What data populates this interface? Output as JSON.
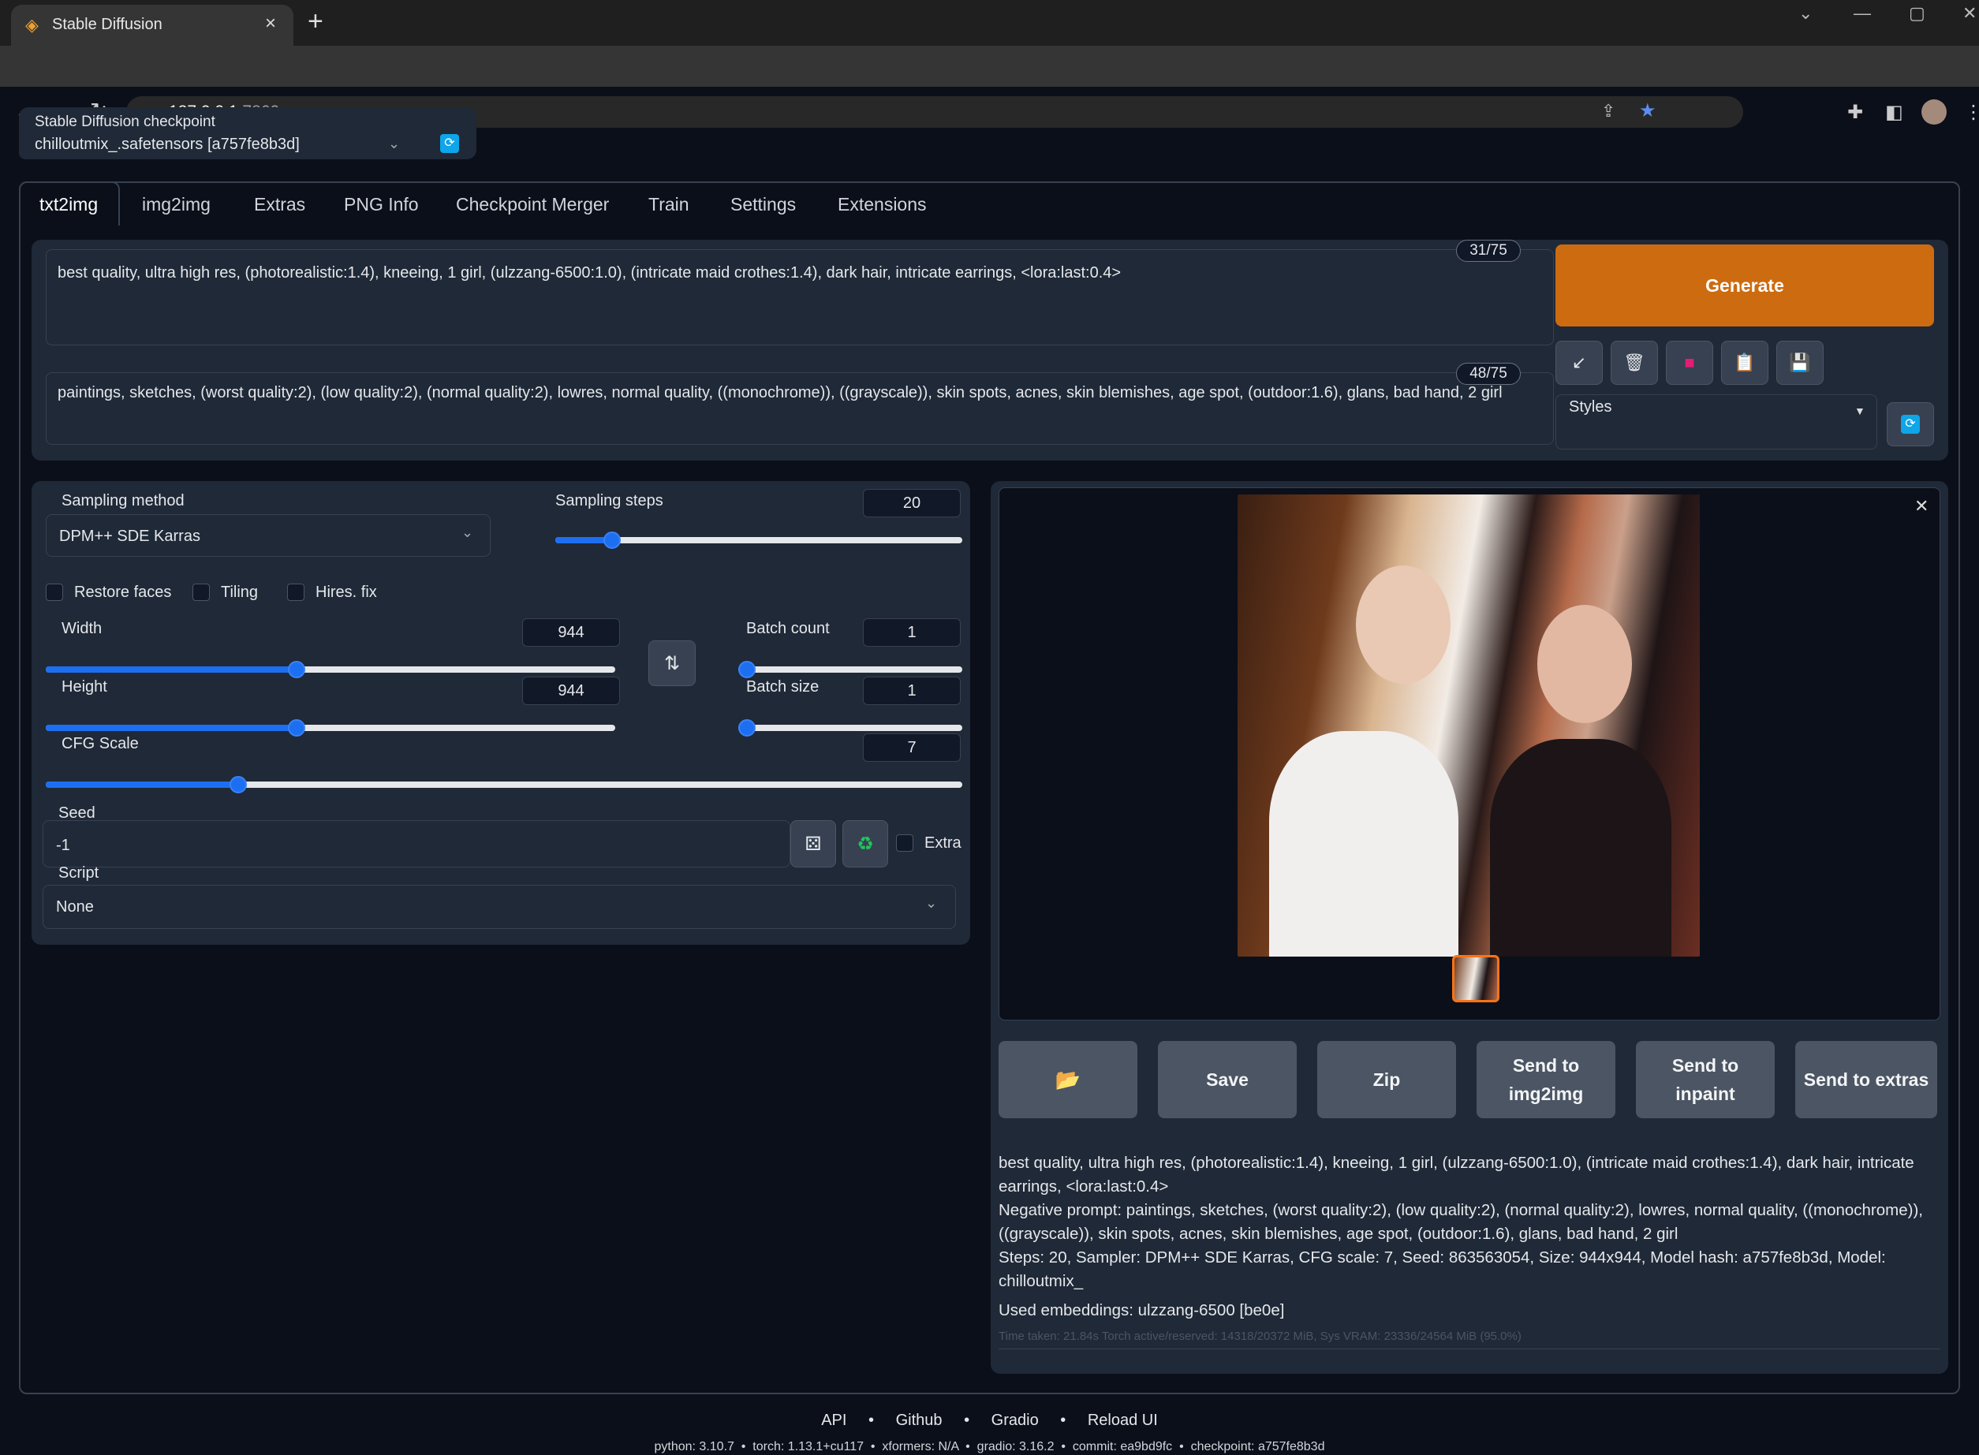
{
  "browser": {
    "tab_title": "Stable Diffusion",
    "url_host": "127.0.0.1",
    "url_port": ":7860"
  },
  "checkpoint": {
    "label": "Stable Diffusion checkpoint",
    "value": "chilloutmix_.safetensors [a757fe8b3d]"
  },
  "tabs": [
    "txt2img",
    "img2img",
    "Extras",
    "PNG Info",
    "Checkpoint Merger",
    "Train",
    "Settings",
    "Extensions"
  ],
  "prompt": {
    "positive": "best quality, ultra high res, (photorealistic:1.4), kneeing, 1 girl, (ulzzang-6500:1.0), (intricate maid crothes:1.4), dark hair, intricate earrings, <lora:last:0.4>",
    "positive_count": "31/75",
    "negative": "paintings, sketches, (worst quality:2), (low quality:2), (normal quality:2), lowres, normal quality, ((monochrome)), ((grayscale)), skin spots, acnes, skin blemishes, age spot, (outdoor:1.6), glans, bad hand, 2 girl",
    "negative_count": "48/75"
  },
  "generate_label": "Generate",
  "styles_label": "Styles",
  "params": {
    "sampling_method_label": "Sampling method",
    "sampling_method": "DPM++ SDE Karras",
    "sampling_steps_label": "Sampling steps",
    "sampling_steps": "20",
    "sampling_steps_fraction": 0.14,
    "restore_faces": "Restore faces",
    "tiling": "Tiling",
    "hires_fix": "Hires. fix",
    "width_label": "Width",
    "width": "944",
    "width_fraction": 0.44,
    "height_label": "Height",
    "height": "944",
    "height_fraction": 0.44,
    "batch_count_label": "Batch count",
    "batch_count": "1",
    "batch_count_fraction": 0.0,
    "batch_size_label": "Batch size",
    "batch_size": "1",
    "batch_size_fraction": 0.0,
    "cfg_label": "CFG Scale",
    "cfg": "7",
    "cfg_fraction": 0.21,
    "seed_label": "Seed",
    "seed": "-1",
    "extra_label": "Extra",
    "script_label": "Script",
    "script": "None"
  },
  "output_buttons": {
    "save": "Save",
    "zip": "Zip",
    "send_img2img": "Send to img2img",
    "send_inpaint": "Send to inpaint",
    "send_extras": "Send to extras"
  },
  "info": {
    "line1": "best quality, ultra high res, (photorealistic:1.4), kneeing, 1 girl, (ulzzang-6500:1.0), (intricate maid crothes:1.4), dark hair, intricate earrings, <lora:last:0.4>",
    "line2": "Negative prompt: paintings, sketches, (worst quality:2), (low quality:2), (normal quality:2), lowres, normal quality, ((monochrome)), ((grayscale)), skin spots, acnes, skin blemishes, age spot, (outdoor:1.6), glans, bad hand, 2 girl",
    "line3": "Steps: 20, Sampler: DPM++ SDE Karras, CFG scale: 7, Seed: 863563054, Size: 944x944, Model hash: a757fe8b3d, Model: chilloutmix_",
    "embeddings": "Used embeddings: ulzzang-6500 [be0e]",
    "time": "Time taken: 21.84s  Torch active/reserved: 14318/20372 MiB, Sys VRAM: 23336/24564 MiB (95.0%)"
  },
  "footer": {
    "links": [
      "API",
      "Github",
      "Gradio",
      "Reload UI"
    ],
    "versions": "python: 3.10.7  •  torch: 1.13.1+cu117  •  xformers: N/A  •  gradio: 3.16.2  •  commit: ea9bd9fc  •  checkpoint: a757fe8b3d"
  },
  "colors": {
    "accent": "#1d6ff2",
    "generate": "#cc6b10",
    "bg": "#0b0f19",
    "panel": "#1f2937"
  }
}
